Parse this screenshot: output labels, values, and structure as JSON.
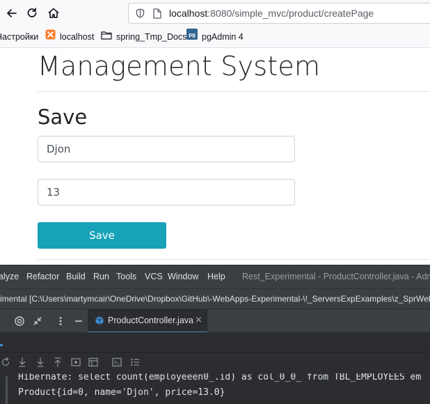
{
  "browser": {
    "nav": {
      "back_icon": "arrow-left-icon",
      "reload_icon": "reload-icon",
      "home_icon": "home-icon"
    },
    "url": {
      "host": "localhost",
      "rest": ":8080/simple_mvc/product/createPage"
    },
    "bookmarks": [
      {
        "label": "Настройки",
        "icon": ""
      },
      {
        "label": "localhost",
        "icon": "xampp-icon"
      },
      {
        "label": "spring_Tmp_Docs",
        "icon": "folder-icon"
      },
      {
        "label": "pgAdmin 4",
        "icon": "pgadmin-icon"
      }
    ]
  },
  "page": {
    "title": "Management System",
    "section_title": "Save",
    "name_value": "Djon",
    "price_value": "13",
    "save_label": "Save",
    "colors": {
      "button": "#17a2b8",
      "text": "#212529"
    }
  },
  "ide": {
    "menu": [
      "alyze",
      "Refactor",
      "Build",
      "Run",
      "Tools",
      "VCS",
      "Window",
      "Help"
    ],
    "window_title": "Rest_Experimental - ProductController.java - Admin",
    "path": "imental [C:\\Users\\martymcair\\OneDrive\\Dropbox\\GitHub\\-WebApps-Experimental-\\!_ServersExpExamples\\z_SprWebMv",
    "tab": {
      "label": "ProductController.java",
      "close": "×"
    },
    "console": [
      "Hibernate: select count(employeeen0_.id) as col_0_0_ from TBL_EMPLOYEES em",
      "Product{id=0, name='Djon', price=13.0}"
    ],
    "colors": {
      "background": "#2b2d30",
      "menubar": "#3c3f41",
      "accent": "#4a88c7"
    }
  }
}
